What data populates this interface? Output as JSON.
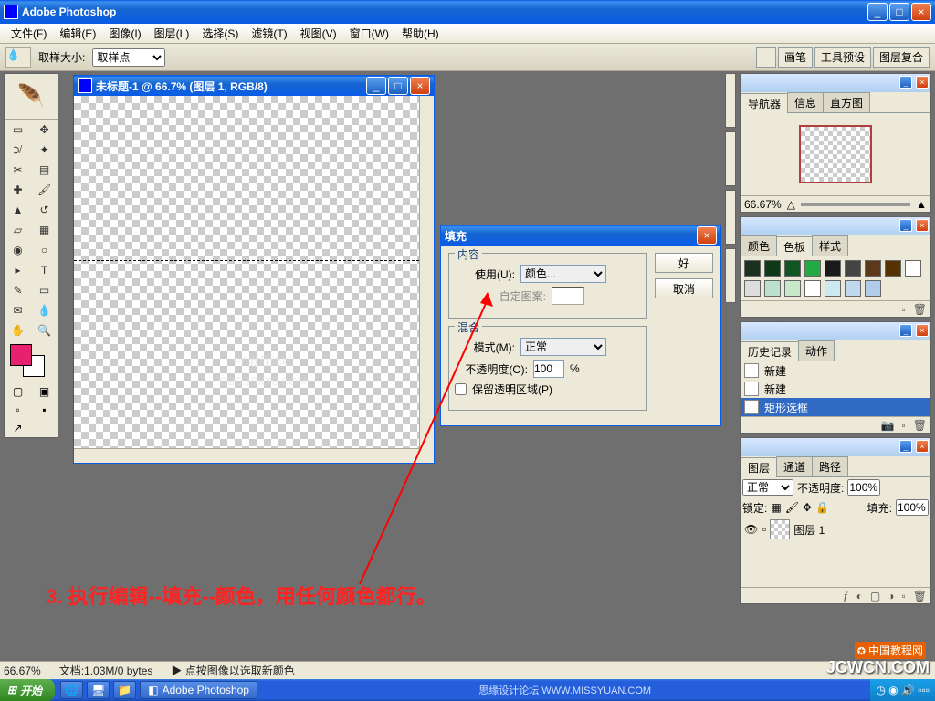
{
  "app": {
    "title": "Adobe Photoshop"
  },
  "menu": [
    "文件(F)",
    "编辑(E)",
    "图像(I)",
    "图层(L)",
    "选择(S)",
    "滤镜(T)",
    "视图(V)",
    "窗口(W)",
    "帮助(H)"
  ],
  "options": {
    "label": "取样大小:",
    "value": "取样点",
    "rightTabs": [
      "画笔",
      "工具预设",
      "图层复合"
    ]
  },
  "doc": {
    "title": "未标题-1 @ 66.7% (图层 1, RGB/8)"
  },
  "dialog": {
    "title": "填充",
    "contentLegend": "内容",
    "useLabel": "使用(U):",
    "useValue": "颜色...",
    "patternLabel": "自定图案:",
    "blendLegend": "混合",
    "modeLabel": "模式(M):",
    "modeValue": "正常",
    "opacityLabel": "不透明度(O):",
    "opacityValue": "100",
    "opacityUnit": "%",
    "preserveLabel": "保留透明区域(P)",
    "ok": "好",
    "cancel": "取消"
  },
  "annotation": "3. 执行编辑--填充--颜色，用任何颜色都行。",
  "panels": {
    "nav": {
      "tabs": [
        "导航器",
        "信息",
        "直方图"
      ],
      "zoom": "66.67%"
    },
    "color": {
      "tabs": [
        "颜色",
        "色板",
        "样式"
      ]
    },
    "history": {
      "tabs": [
        "历史记录",
        "动作"
      ],
      "items": [
        {
          "label": "新建",
          "sel": false
        },
        {
          "label": "新建",
          "sel": false
        },
        {
          "label": "矩形选框",
          "sel": true
        }
      ]
    },
    "layers": {
      "tabs": [
        "图层",
        "通道",
        "路径"
      ],
      "mode": "正常",
      "opacityLabel": "不透明度:",
      "opacityValue": "100%",
      "lockLabel": "锁定:",
      "fillLabel": "填充:",
      "fillValue": "100%",
      "layer1": "图层 1"
    }
  },
  "status": {
    "zoom": "66.67%",
    "docinfo": "文档:1.03M/0 bytes",
    "hint": "点按图像以选取新颜色"
  },
  "taskbar": {
    "start": "开始",
    "app": "Adobe Photoshop",
    "center": "思缘设计论坛 WWW.MISSYUAN.COM"
  },
  "watermarks": {
    "canvas1": "PS教程论坛",
    "canvas2": "BBS.16XX8.COM",
    "br1": "中国教程网",
    "br2": "JCWCN.COM"
  },
  "swatchColors": [
    "#1a3020",
    "#0f3a17",
    "#115522",
    "#22aa44",
    "#1a1a1a",
    "#444",
    "#5a3a1a",
    "#553300",
    "#fff",
    "#ddd",
    "#bbe0cc",
    "#c8e8cc",
    "#fff",
    "#cce8f0",
    "#c0d8ee",
    "#b0ccea"
  ]
}
